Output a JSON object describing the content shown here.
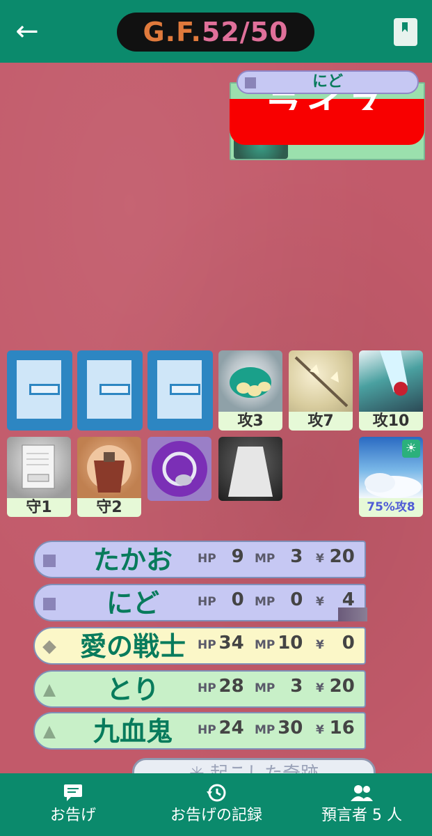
{
  "header": {
    "gf_label": "G.F.",
    "gf_current": "52",
    "gf_max": "/50"
  },
  "enemy": {
    "name": "にど",
    "banner_text": "ライス"
  },
  "cards_row1": [
    {
      "type": "blank"
    },
    {
      "type": "blank"
    },
    {
      "type": "blank"
    },
    {
      "label": "攻3"
    },
    {
      "label": "攻7"
    },
    {
      "label": "攻10"
    }
  ],
  "cards_row2": [
    {
      "label": "守1"
    },
    {
      "label": "守2"
    },
    {
      "label": ""
    },
    {
      "label": ""
    },
    {
      "label": "75%攻8"
    }
  ],
  "players": [
    {
      "name": "たかお",
      "hp_label": "HP",
      "hp": "9",
      "mp_label": "MP",
      "mp": "3",
      "yen_label": "¥",
      "yen": "20"
    },
    {
      "name": "にど",
      "hp_label": "HP",
      "hp": "0",
      "mp_label": "MP",
      "mp": "0",
      "yen_label": "¥",
      "yen": "4"
    },
    {
      "name": "愛の戦士",
      "hp_label": "HP",
      "hp": "34",
      "mp_label": "MP",
      "mp": "10",
      "yen_label": "¥",
      "yen": "0"
    },
    {
      "name": "とり",
      "hp_label": "HP",
      "hp": "28",
      "mp_label": "MP",
      "mp": "3",
      "yen_label": "¥",
      "yen": "20"
    },
    {
      "name": "九血鬼",
      "hp_label": "HP",
      "hp": "24",
      "mp_label": "MP",
      "mp": "30",
      "yen_label": "¥",
      "yen": "16"
    }
  ],
  "bottom_peek_text": "起こした奇跡",
  "tabs": [
    {
      "label": "お告げ",
      "icon": "chat-icon"
    },
    {
      "label": "お告げの記録",
      "icon": "history-icon"
    },
    {
      "label": "預言者 5 人",
      "icon": "people-icon"
    }
  ]
}
